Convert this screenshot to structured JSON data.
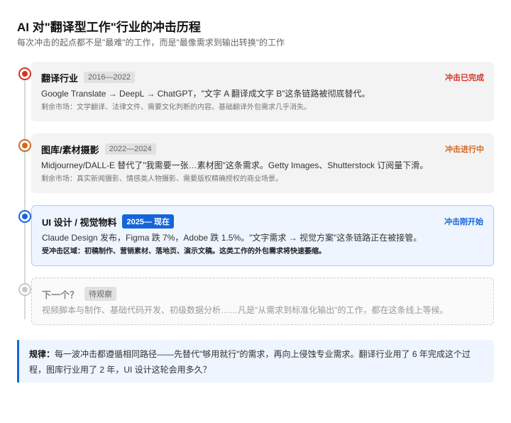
{
  "title": "AI 对\"翻译型工作\"行业的冲击历程",
  "subtitle": "每次冲击的起点都不是\"最难\"的工作，而是\"最像需求到输出转换\"的工作",
  "stages": [
    {
      "name": "翻译行业",
      "period": "2016—2022",
      "status": "冲击已完成",
      "status_color": "#d93025",
      "desc": "Google Translate → DeepL → ChatGPT，\"文字 A 翻译成文字 B\"这条链路被彻底替代。",
      "note": "剩余市场：文学翻译、法律文件、需要文化判断的内容。基础翻译外包需求几乎消失。"
    },
    {
      "name": "图库/素材摄影",
      "period": "2022—2024",
      "status": "冲击进行中",
      "status_color": "#d2691e",
      "desc": "Midjourney/DALL-E 替代了\"我需要一张…素材图\"这条需求。Getty Images、Shutterstock 订阅量下滑。",
      "note": "剩余市场：真实新闻摄影、情感类人物摄影、需要版权精确授权的商业场景。"
    },
    {
      "name": "UI 设计 / 视觉物料",
      "period": "2025— 现在",
      "status": "冲击刚开始",
      "status_color": "#1565d8",
      "desc": "Claude Design 发布，Figma 跌 7%，Adobe 跌 1.5%。\"文字需求 → 视觉方案\"这条链路正在被接管。",
      "note": "受冲击区域：初稿制作、营销素材、落地页、演示文稿。这类工作的外包需求将快速萎缩。"
    },
    {
      "name": "下一个？",
      "period": "待观察",
      "desc": "视频脚本与制作、基础代码开发、初级数据分析……凡是\"从需求到标准化输出\"的工作，都在这条线上等候。"
    }
  ],
  "rule": {
    "label": "规律：",
    "text": "每一波冲击都遵循相同路径——先替代\"够用就行\"的需求，再向上侵蚀专业需求。翻译行业用了 6 年完成这个过程，图库行业用了 2 年，UI 设计这轮会用多久？"
  }
}
